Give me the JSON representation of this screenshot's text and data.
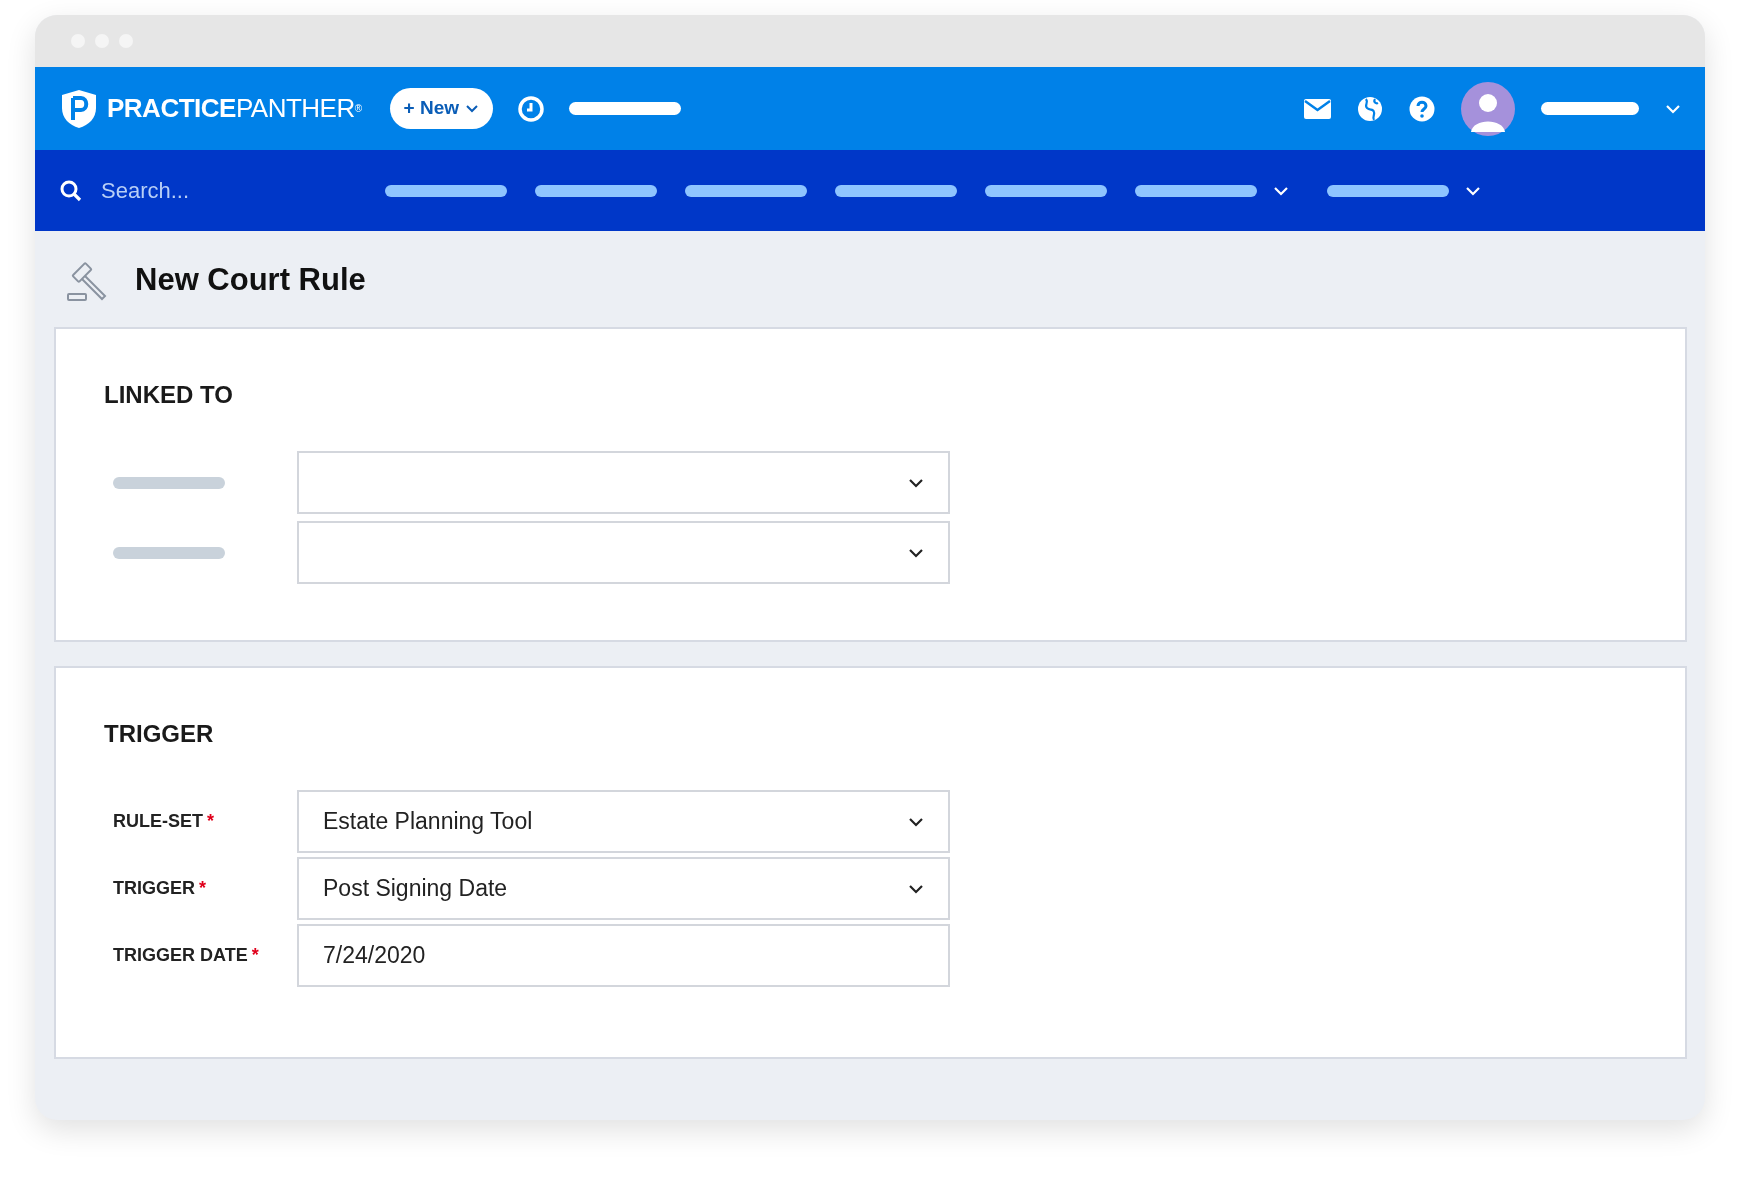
{
  "brand": {
    "strong": "PRACTICE",
    "light": "PANTHER",
    "mark": "®"
  },
  "new_button": {
    "label": "+ New"
  },
  "nav_links": [
    {
      "dropdown": false
    },
    {
      "dropdown": false
    },
    {
      "dropdown": false
    },
    {
      "dropdown": false
    },
    {
      "dropdown": false
    },
    {
      "dropdown": true
    },
    {
      "dropdown": true
    }
  ],
  "search": {
    "placeholder": "Search..."
  },
  "page": {
    "title": "New Court Rule"
  },
  "sections": [
    {
      "title": "LINKED TO",
      "fields": [
        {
          "kind": "select"
        },
        {
          "kind": "select"
        }
      ]
    },
    {
      "title": "TRIGGER",
      "fields": [
        {
          "kind": "select",
          "label": "RULE-SET",
          "required_mark": "*",
          "value": "Estate Planning Tool"
        },
        {
          "kind": "select",
          "label": "TRIGGER",
          "required_mark": "*",
          "value": "Post Signing Date"
        },
        {
          "kind": "text",
          "label": "TRIGGER DATE",
          "required_mark": "*",
          "value": "7/24/2020"
        }
      ]
    }
  ]
}
